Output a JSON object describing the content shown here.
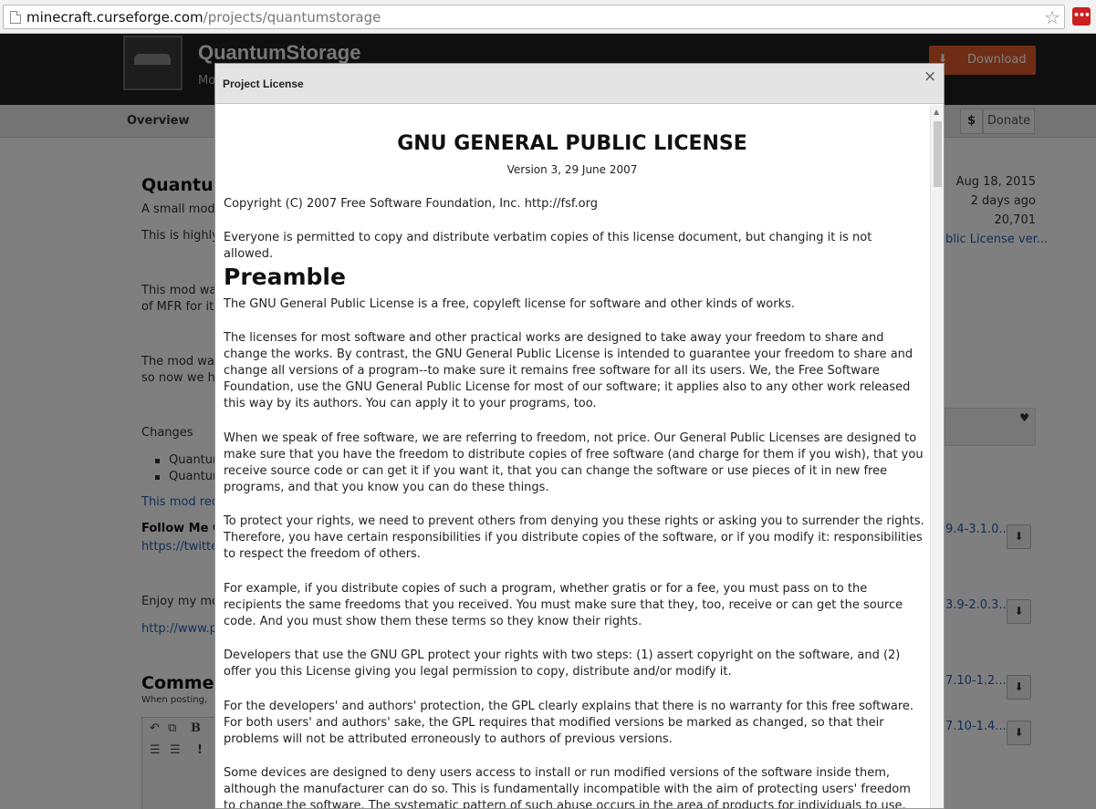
{
  "browser": {
    "url_host": "minecraft.curseforge.com",
    "url_path": "/projects/quantumstorage",
    "star_icon": "star-outline-icon",
    "extension_icon": "red-dots-extension-icon",
    "extension_label": "•••"
  },
  "site": {
    "project_title": "QuantumStorage",
    "project_subtitle": "Mo",
    "download_label": "Download",
    "nav_overview": "Overview",
    "donate_symbol": "$",
    "donate_label": "Donate",
    "main_heading": "Quantur",
    "lines": [
      "A small mod",
      "This is highly",
      "This mod was",
      "of MFR for it.",
      "The mod was",
      "so now we ha",
      "Changes",
      "Quantur",
      "Quantur",
      "This mod req",
      "Follow Me O",
      "https://twitte",
      "Enjoy my mo",
      "http://www.p",
      "Commen",
      "When posting,"
    ],
    "sidebar": {
      "date": "Aug 18, 2015",
      "updated": "2 days ago",
      "downloads": "20,701",
      "license_link": "blic License ver...",
      "files": [
        "9.4-3.1.0...",
        "3.9-2.0.3...",
        "7.10-1.2...",
        "7.10-1.4..."
      ]
    }
  },
  "modal": {
    "title": "Project License",
    "close_label": "×",
    "license_title": "GNU GENERAL PUBLIC LICENSE",
    "license_version": "Version 3, 29 June 2007",
    "copyright": "Copyright (C) 2007 Free Software Foundation, Inc. http://fsf.org",
    "everyone": "Everyone is permitted to copy and distribute verbatim copies of this license document, but changing it is not allowed.",
    "preamble_heading": "Preamble",
    "paragraphs": [
      "The GNU General Public License is a free, copyleft license for software and other kinds of works.",
      "The licenses for most software and other practical works are designed to take away your freedom to share and change the works. By contrast, the GNU General Public License is intended to guarantee your freedom to share and change all versions of a program--to make sure it remains free software for all its users. We, the Free Software Foundation, use the GNU General Public License for most of our software; it applies also to any other work released this way by its authors. You can apply it to your programs, too.",
      "When we speak of free software, we are referring to freedom, not price. Our General Public Licenses are designed to make sure that you have the freedom to distribute copies of free software (and charge for them if you wish), that you receive source code or can get it if you want it, that you can change the software or use pieces of it in new free programs, and that you know you can do these things.",
      "To protect your rights, we need to prevent others from denying you these rights or asking you to surrender the rights. Therefore, you have certain responsibilities if you distribute copies of the software, or if you modify it: responsibilities to respect the freedom of others.",
      "For example, if you distribute copies of such a program, whether gratis or for a fee, you must pass on to the recipients the same freedoms that you received. You must make sure that they, too, receive or can get the source code. And you must show them these terms so they know their rights.",
      "Developers that use the GNU GPL protect your rights with two steps: (1) assert copyright on the software, and (2) offer you this License giving you legal permission to copy, distribute and/or modify it.",
      "For the developers' and authors' protection, the GPL clearly explains that there is no warranty for this free software. For both users' and authors' sake, the GPL requires that modified versions be marked as changed, so that their problems will not be attributed erroneously to authors of previous versions.",
      "Some devices are designed to deny users access to install or run modified versions of the software inside them, although the manufacturer can do so. This is fundamentally incompatible with the aim of protecting users' freedom to change the software. The systematic pattern of such abuse occurs in the area of products for individuals to use, which is precisely where"
    ]
  }
}
